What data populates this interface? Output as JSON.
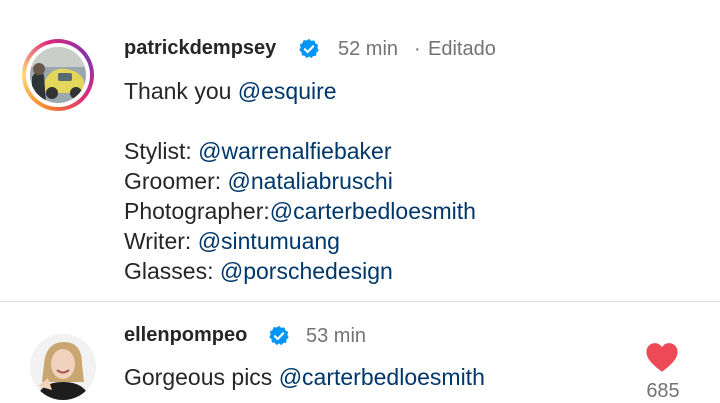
{
  "post": {
    "username": "patrickdempsey",
    "time": "52 min",
    "separator": "·",
    "edited": "Editado",
    "caption": {
      "line1_text": "Thank you ",
      "line1_mention": "@esquire",
      "credits": [
        {
          "label": "Stylist: ",
          "mention": "@warrenalfiebaker"
        },
        {
          "label": "Groomer: ",
          "mention": "@nataliabruschi"
        },
        {
          "label": "Photographer:",
          "mention": "@carterbedloesmith"
        },
        {
          "label": "Writer: ",
          "mention": "@sintumuang"
        },
        {
          "label": "Glasses: ",
          "mention": "@porschedesign"
        }
      ]
    }
  },
  "comment": {
    "username": "ellenpompeo",
    "time": "53 min",
    "text": "Gorgeous pics ",
    "mention": "@carterbedloesmith",
    "likes": "685"
  },
  "colors": {
    "mention": "#00376b",
    "verified": "#0095f6",
    "like": "#ed4956",
    "muted": "#737373"
  },
  "icons": {
    "verified": "verified-badge-icon",
    "like": "heart-filled-icon"
  }
}
